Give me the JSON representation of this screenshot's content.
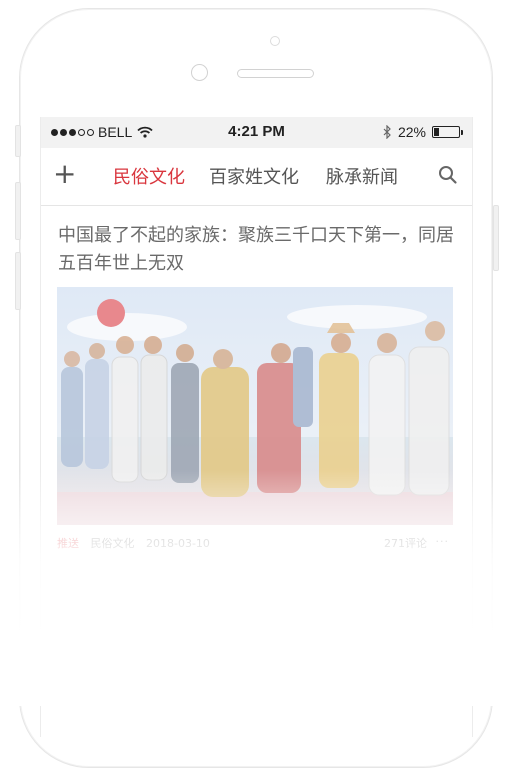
{
  "status_bar": {
    "carrier": "BELL",
    "time": "4:21 PM",
    "battery_percent": "22%",
    "battery_level": 0.22,
    "signal_icon": "signal-dots-icon",
    "wifi_icon": "wifi-icon",
    "bluetooth_icon": "bluetooth-icon"
  },
  "nav": {
    "add_icon": "plus-icon",
    "tabs": [
      {
        "label": "民俗文化",
        "active": true
      },
      {
        "label": "百家姓文化",
        "active": false
      },
      {
        "label": "脉承新闻",
        "active": false
      }
    ],
    "search_icon": "search-icon",
    "accent_color": "#d9363e"
  },
  "article": {
    "headline": "中国最了不起的家族：聚族三千口天下第一，同居五百年世上无双",
    "meta_tag": "推送",
    "meta_source": "民俗文化",
    "meta_time": "2018-03-10",
    "meta_count": "271评论",
    "more_icon": "more-icon"
  }
}
